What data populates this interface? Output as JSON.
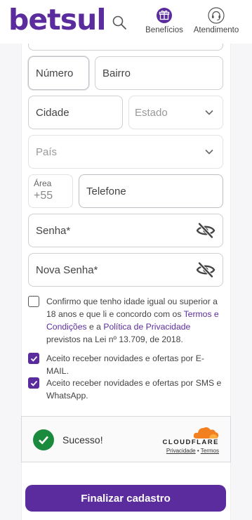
{
  "header": {
    "logo": "betsul",
    "beneficios_label": "Benefícios",
    "atendimento_label": "Atendimento"
  },
  "form": {
    "numero_placeholder": "Número",
    "bairro_placeholder": "Bairro",
    "cidade_placeholder": "Cidade",
    "estado_placeholder": "Estado",
    "pais_placeholder": "País",
    "area_label": "Área",
    "area_value": "+55",
    "telefone_placeholder": "Telefone",
    "senha_placeholder": "Senha*",
    "nova_senha_placeholder": "Nova Senha*"
  },
  "consent": {
    "age": {
      "checked": false,
      "text_1": "Confirmo que tenho idade igual ou superior a 18 anos e que li e concordo com os ",
      "link_termos": "Termos e Condições",
      "text_2": " e a ",
      "link_privacidade": "Política de Privacidade",
      "text_3": " previstos na Lei nº 13.709, de 2018."
    },
    "email": {
      "checked": true,
      "text": "Aceito receber novidades e ofertas por E-MAIL."
    },
    "sms": {
      "checked": true,
      "text": "Aceito receber novidades e ofertas por SMS e WhatsApp."
    }
  },
  "captcha": {
    "status": "Sucesso!",
    "brand": "CLOUDFLARE",
    "privacy_link": "Privacidade",
    "separator": "•",
    "terms_link": "Termos"
  },
  "submit_label": "Finalizar cadastro",
  "colors": {
    "brand_purple": "#5b2c9e",
    "success_green": "#1a8a3c",
    "cloudflare_orange": "#f38020"
  },
  "icons": [
    "search-icon",
    "gift-icon",
    "headset-icon",
    "chevron-down-icon",
    "eye-off-icon",
    "check-icon",
    "cloud-icon"
  ]
}
